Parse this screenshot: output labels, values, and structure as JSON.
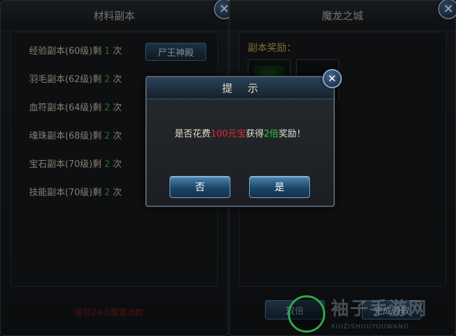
{
  "left_panel": {
    "title": "材料副本",
    "dungeons": [
      {
        "name": "经验副本(60级)",
        "remain_label": "剩",
        "count": "1",
        "unit": "次"
      },
      {
        "name": "羽毛副本(62级)",
        "remain_label": "剩",
        "count": "2",
        "unit": "次"
      },
      {
        "name": "血符副本(64级)",
        "remain_label": "剩",
        "count": "2",
        "unit": "次"
      },
      {
        "name": "魂珠副本(68级)",
        "remain_label": "剩",
        "count": "2",
        "unit": "次"
      },
      {
        "name": "宝石副本(70级)",
        "remain_label": "剩",
        "count": "2",
        "unit": "次"
      },
      {
        "name": "技能副本(70级)",
        "remain_label": "剩",
        "count": "2",
        "unit": "次"
      }
    ],
    "dungeon_button": "尸王神殿",
    "reset_note": "每日24点重置次数"
  },
  "right_panel": {
    "title": "魔龙之城",
    "reward_title": "副本奖励：",
    "complete_button": "完成领取",
    "double_button": "双倍"
  },
  "dialog": {
    "title": "提示",
    "message": {
      "prefix": "是否花费",
      "cost": "100元宝",
      "middle": "获得",
      "multiplier": "2倍",
      "suffix": "奖励！"
    },
    "no_button": "否",
    "yes_button": "是"
  },
  "watermark": {
    "text": "袖子手游网",
    "sub": "XIUZISHOUYOUWANG"
  },
  "colors": {
    "cost": "#e02a2a",
    "multiplier": "#35c535",
    "count": "#3aa93a"
  }
}
